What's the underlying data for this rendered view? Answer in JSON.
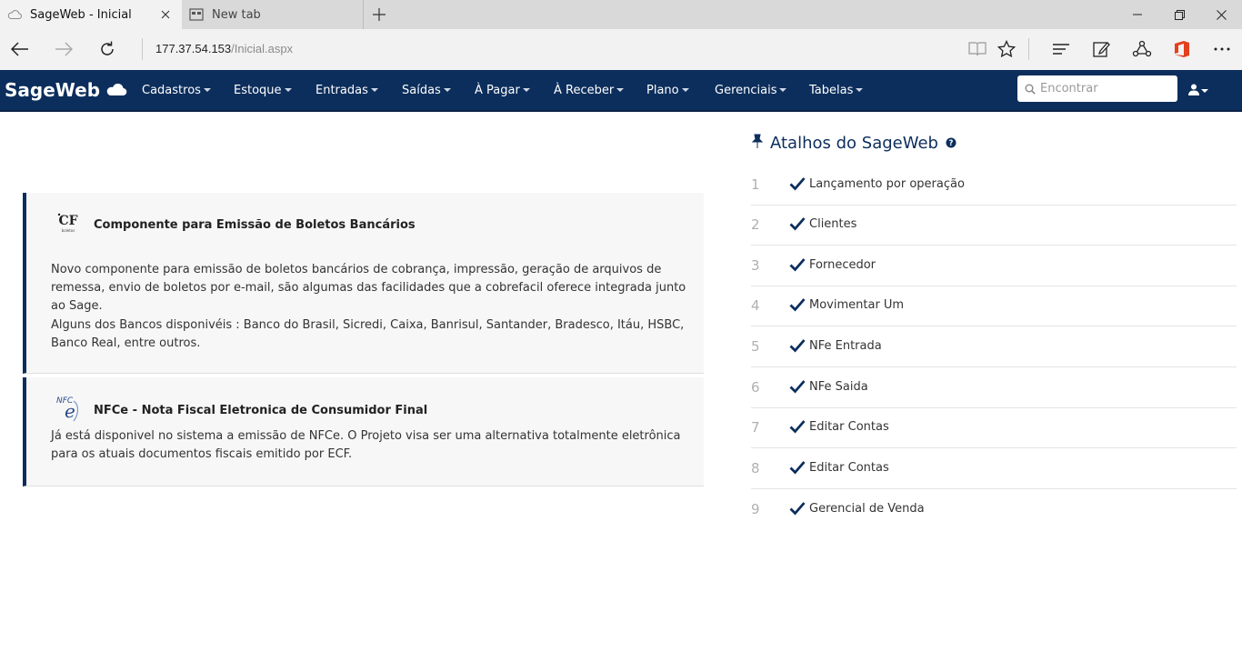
{
  "browser": {
    "tabs": [
      {
        "title": "SageWeb - Inicial",
        "active": true
      },
      {
        "title": "New tab",
        "active": false
      }
    ],
    "url": {
      "host": "177.37.54.153",
      "path": "/Inicial.aspx"
    }
  },
  "app": {
    "brand": "SageWeb",
    "menu": [
      {
        "label": "Cadastros"
      },
      {
        "label": "Estoque"
      },
      {
        "label": "Entradas"
      },
      {
        "label": "Saídas"
      },
      {
        "label": "À Pagar"
      },
      {
        "label": "À Receber"
      },
      {
        "label": "Plano"
      },
      {
        "label": "Gerenciais"
      },
      {
        "label": "Tabelas"
      }
    ],
    "search_placeholder": "Encontrar",
    "colors": {
      "navbar": "#0c2e5c",
      "accent": "#0c2e5c"
    }
  },
  "news": [
    {
      "title": "Componente para Emissão de Boletos Bancários",
      "icon_text": "CF",
      "paragraphs": [
        "Novo componente para emissão de boletos bancários de cobrança, impressão, geração de arquivos de remessa, envio de boletos por e-mail, são algumas das facilidades que a cobrefacil oferece integrada junto ao Sage.",
        "Alguns dos Bancos disponivéis : Banco do Brasil, Sicredi, Caixa, Banrisul, Santander, Bradesco, Itáu, HSBC, Banco Real, entre outros."
      ]
    },
    {
      "title": "NFCe - Nota Fiscal Eletronica de Consumidor Final",
      "icon_text": "NFC e",
      "paragraphs": [
        "Já está disponivel no sistema a emissão de NFCe. O Projeto visa ser uma alternativa totalmente eletrônica para os atuais documentos fiscais emitido por ECF."
      ]
    }
  ],
  "shortcuts": {
    "title": "Atalhos do SageWeb",
    "items": [
      {
        "num": "1",
        "label": "Lançamento por operação"
      },
      {
        "num": "2",
        "label": "Clientes"
      },
      {
        "num": "3",
        "label": "Fornecedor"
      },
      {
        "num": "4",
        "label": "Movimentar Um"
      },
      {
        "num": "5",
        "label": "NFe Entrada"
      },
      {
        "num": "6",
        "label": "NFe Saida"
      },
      {
        "num": "7",
        "label": "Editar Contas"
      },
      {
        "num": "8",
        "label": "Editar Contas"
      },
      {
        "num": "9",
        "label": "Gerencial de Venda"
      }
    ]
  }
}
